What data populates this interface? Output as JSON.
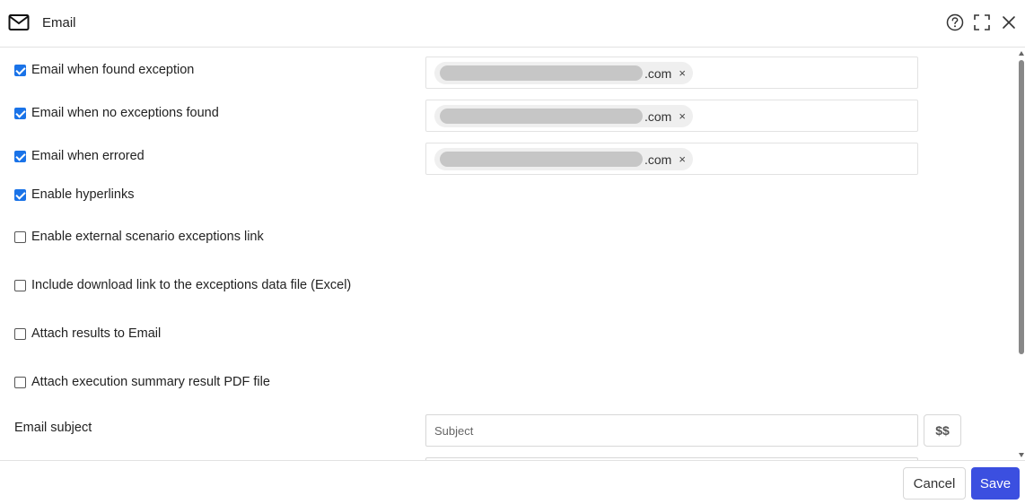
{
  "header": {
    "title": "Email",
    "icons": {
      "mail": "mail-icon",
      "help": "help-icon",
      "expand": "expand-icon",
      "close": "close-icon"
    }
  },
  "options": [
    {
      "label": "Email when found exception",
      "checked": true
    },
    {
      "label": "Email when no exceptions found",
      "checked": true
    },
    {
      "label": "Email when errored",
      "checked": true
    },
    {
      "label": "Enable hyperlinks",
      "checked": true
    },
    {
      "label": "Enable external scenario exceptions link",
      "checked": false
    },
    {
      "label": "Include download link to the exceptions data file (Excel)",
      "checked": false
    },
    {
      "label": "Attach results to Email",
      "checked": false
    },
    {
      "label": "Attach execution summary result PDF file",
      "checked": false
    }
  ],
  "recipients": [
    {
      "suffix": ".com",
      "remove": "×"
    },
    {
      "suffix": ".com",
      "remove": "×"
    },
    {
      "suffix": ".com",
      "remove": "×"
    }
  ],
  "subject": {
    "label": "Email subject",
    "placeholder": "Subject",
    "value": "",
    "variable_button": "$$"
  },
  "footer": {
    "cancel": "Cancel",
    "save": "Save"
  },
  "colors": {
    "accent": "#3b4fe0",
    "checkbox": "#1a73e8"
  }
}
